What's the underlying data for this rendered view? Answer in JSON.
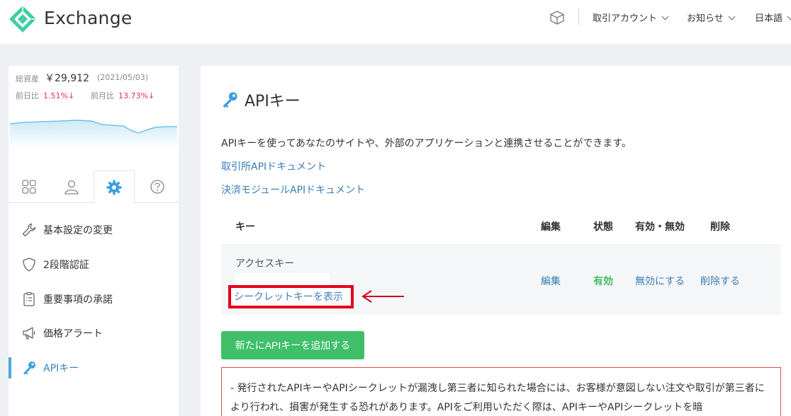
{
  "header": {
    "brand": "Exchange",
    "menus": [
      {
        "label": "取引アカウント"
      },
      {
        "label": "お知らせ"
      },
      {
        "label": "日本語"
      }
    ],
    "colors": {
      "logo": "#3ecfa4",
      "background": "#ffffff"
    }
  },
  "sidebar": {
    "assets": {
      "label": "総資産",
      "value": "￥29,912",
      "date": "(2021/05/03)",
      "day_label": "前日比",
      "day_value": "1.51%↓",
      "month_label": "前月比",
      "month_value": "13.73%↓"
    },
    "tabs": [
      {
        "icon": "grid-icon",
        "active": false
      },
      {
        "icon": "user-icon",
        "active": false
      },
      {
        "icon": "gear-icon",
        "active": true
      },
      {
        "icon": "help-icon",
        "active": false
      }
    ],
    "items": [
      {
        "label": "基本設定の変更",
        "icon": "wrench-icon"
      },
      {
        "label": "2段階認証",
        "icon": "shield-icon"
      },
      {
        "label": "重要事項の承諾",
        "icon": "clipboard-icon"
      },
      {
        "label": "価格アラート",
        "icon": "megaphone-icon"
      },
      {
        "label": "APIキー",
        "icon": "key-icon",
        "active": true
      }
    ]
  },
  "main": {
    "title": "APIキー",
    "description": "APIキーを使ってあなたのサイトや、外部のアプリケーションと連携させることができます。",
    "doc_links": [
      "取引所APIドキュメント",
      "決済モジュールAPIドキュメント"
    ],
    "table": {
      "headers": {
        "key": "キー",
        "edit": "編集",
        "status": "状態",
        "toggle": "有効・無効",
        "delete": "削除"
      },
      "row": {
        "access_key_label": "アクセスキー",
        "reveal_secret": "シークレットキーを表示",
        "edit": "編集",
        "status": "有効",
        "toggle": "無効にする",
        "delete": "削除する"
      }
    },
    "add_button": "新たにAPIキーを追加する",
    "warning": "- 発行されたAPIキーやAPIシークレットが漏洩し第三者に知られた場合には、お客様が意図しない注文や取引が第三者により行われ、損害が発生する恐れがあります。APIをご利用いただく際は、APIキーやAPIシークレットを暗"
  },
  "colors": {
    "accent": "#3a86c4",
    "green": "#3fbf6a",
    "highlight": "#e3001a"
  }
}
